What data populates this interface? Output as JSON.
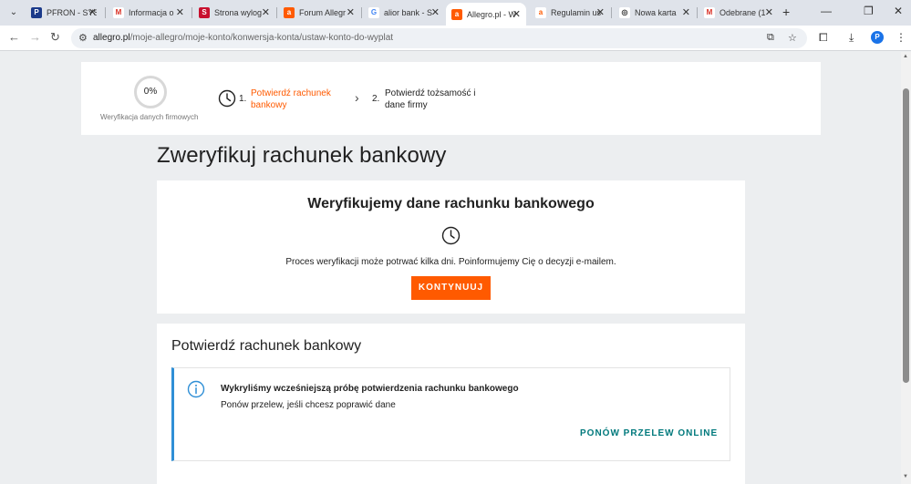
{
  "browser": {
    "tabs": [
      {
        "label": "PFRON - SYS",
        "favicon_color": "#1b3a8a",
        "favicon_text": "P"
      },
      {
        "label": "Informacja o",
        "favicon_color": "#ffffff",
        "favicon_text": "M"
      },
      {
        "label": "Strona wylog",
        "favicon_color": "#c8102e",
        "favicon_text": "S"
      },
      {
        "label": "Forum Allegr",
        "favicon_color": "#ff5a00",
        "favicon_text": "a"
      },
      {
        "label": "alior bank - S",
        "favicon_color": "#ffffff",
        "favicon_text": "G"
      },
      {
        "label": "Allegro.pl - W",
        "favicon_color": "#ff5a00",
        "favicon_text": "a"
      },
      {
        "label": "Regulamin us",
        "favicon_color": "#ffffff",
        "favicon_text": "a"
      },
      {
        "label": "Nowa karta",
        "favicon_color": "#ffffff",
        "favicon_text": "◎"
      },
      {
        "label": "Odebrane (1",
        "favicon_color": "#ffffff",
        "favicon_text": "M"
      }
    ],
    "active_tab_index": 5,
    "url_host": "allegro.pl",
    "url_path": "/moje-allegro/moje-konto/konwersja-konta/ustaw-konto-do-wyplat",
    "profile_initial": "P"
  },
  "steps": {
    "progress_percent": "0%",
    "progress_label": "Weryfikacja danych firmowych",
    "step1_number": "1.",
    "step1_label": "Potwierdź rachunek bankowy",
    "step2_number": "2.",
    "step2_label": "Potwierdź tożsamość i dane firmy"
  },
  "page_title": "Zweryfikuj rachunek bankowy",
  "verify_card": {
    "heading": "Weryfikujemy dane rachunku bankowego",
    "text": "Proces weryfikacji może potrwać kilka dni. Poinformujemy Cię o decyzji e-mailem.",
    "button_label": "KONTYNUUJ"
  },
  "confirm_card": {
    "title": "Potwierdź rachunek bankowy",
    "alert_title": "Wykryliśmy wcześniejszą próbę potwierdzenia rachunku bankowego",
    "alert_desc": "Ponów przelew, jeśli chcesz poprawić dane",
    "alert_link": "PONÓW PRZELEW ONLINE"
  },
  "colors": {
    "accent_orange": "#ff5a00",
    "info_blue": "#2f8fd6",
    "link_teal": "#00797c"
  }
}
